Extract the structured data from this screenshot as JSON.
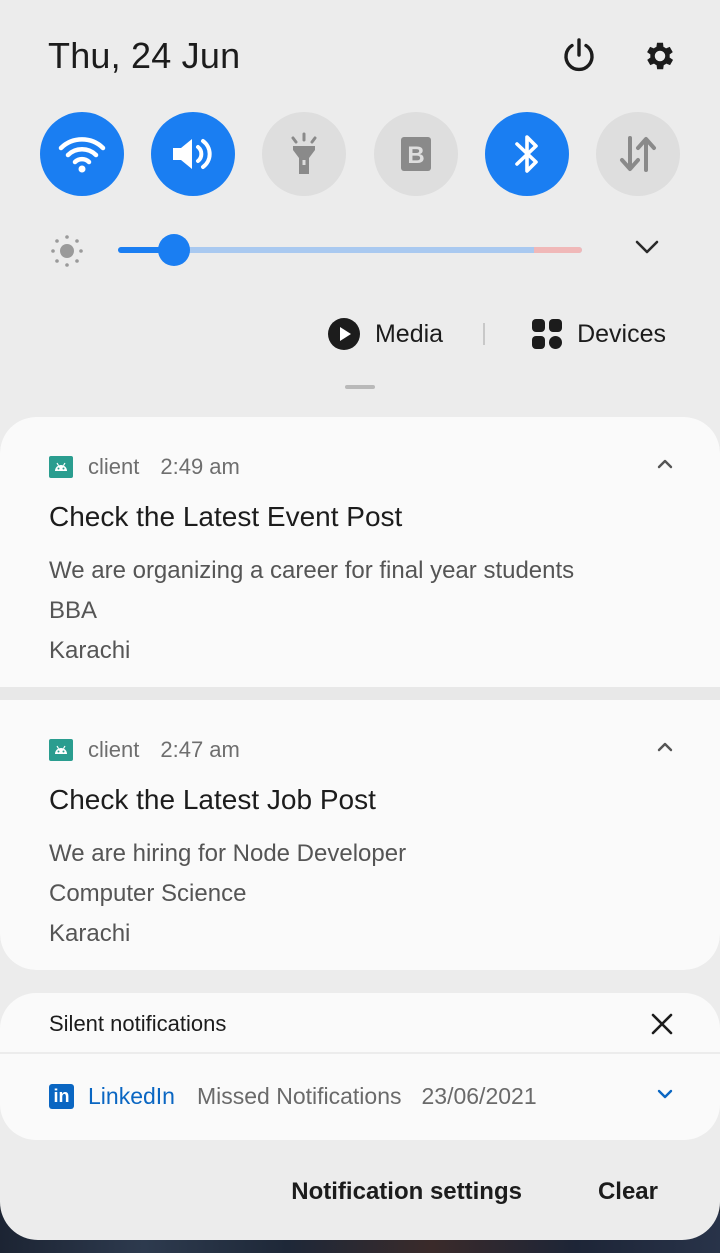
{
  "header": {
    "date": "Thu, 24 Jun",
    "power_icon": "power-icon",
    "settings_icon": "gear-icon"
  },
  "quick_settings": [
    {
      "name": "wifi",
      "icon": "wifi-icon",
      "state": "on"
    },
    {
      "name": "sound",
      "icon": "speaker-icon",
      "state": "on"
    },
    {
      "name": "flashlight",
      "icon": "flashlight-icon",
      "state": "off"
    },
    {
      "name": "bixby",
      "icon": "bixby-icon",
      "state": "off"
    },
    {
      "name": "bluetooth",
      "icon": "bluetooth-icon",
      "state": "on"
    },
    {
      "name": "mobile-data",
      "icon": "data-arrows-icon",
      "state": "off"
    }
  ],
  "brightness": {
    "level": 0.12
  },
  "media_bar": {
    "media_label": "Media",
    "devices_label": "Devices"
  },
  "notifications": [
    {
      "app": "client",
      "time": "2:49 am",
      "title": "Check the Latest Event Post",
      "lines": [
        "We are organizing a career for final year students",
        "BBA",
        "Karachi"
      ]
    },
    {
      "app": "client",
      "time": "2:47 am",
      "title": "Check the Latest Job Post",
      "lines": [
        "We are hiring for Node Developer",
        "Computer Science",
        "Karachi"
      ]
    }
  ],
  "silent": {
    "header": "Silent notifications",
    "item": {
      "logo": "in",
      "app": "LinkedIn",
      "message": "Missed Notifications",
      "date": "23/06/2021"
    }
  },
  "footer": {
    "settings_label": "Notification settings",
    "clear_label": "Clear"
  },
  "colors": {
    "accent": "#1a7ef2",
    "tile_off": "#dedede",
    "linkedin": "#0a66c2"
  }
}
